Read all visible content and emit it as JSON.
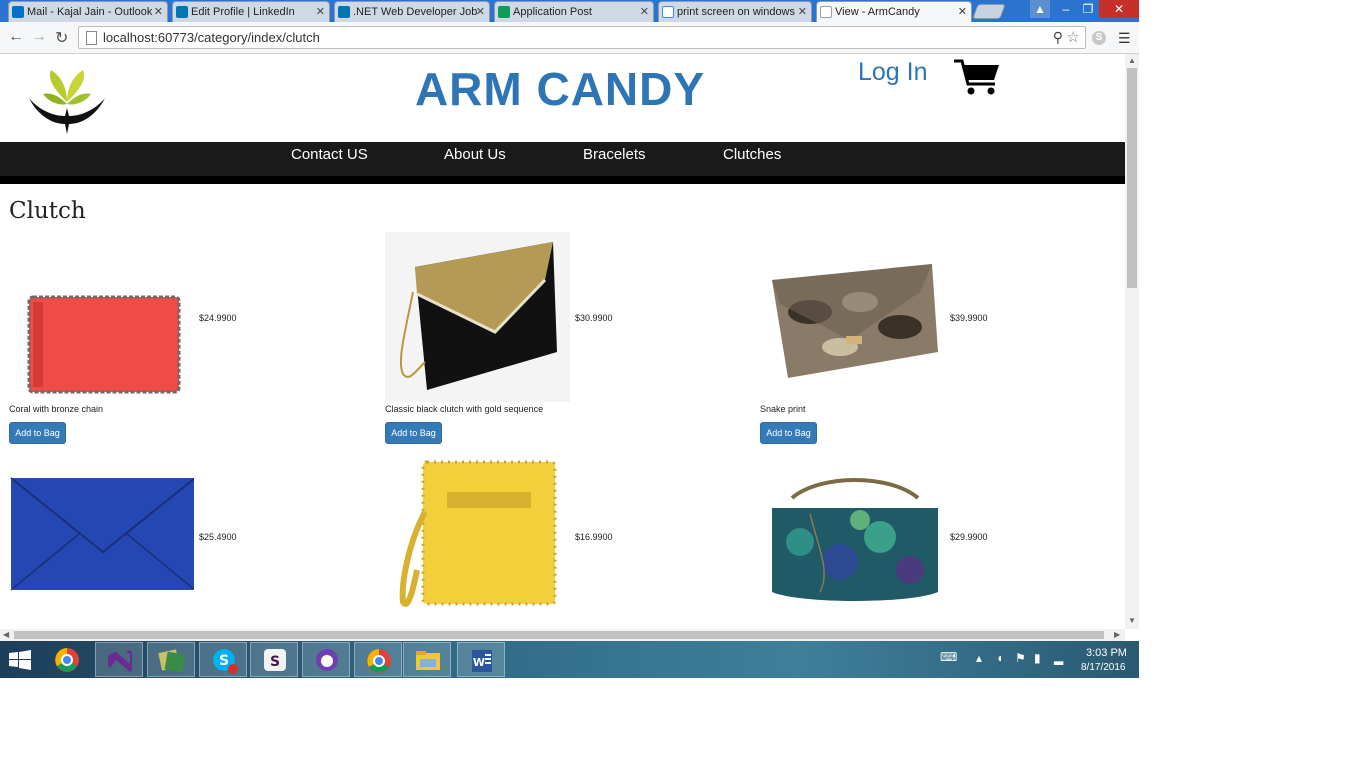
{
  "browser": {
    "tabs": [
      {
        "label": "Mail - Kajal Jain - Outlook",
        "icon": "mail-icon",
        "color": "#0072c6"
      },
      {
        "label": "Edit Profile | LinkedIn",
        "icon": "linkedin-icon",
        "color": "#0077b5"
      },
      {
        "label": ".NET Web Developer Job",
        "icon": "linkedin-icon",
        "color": "#0077b5"
      },
      {
        "label": "Application Post",
        "icon": "sheets-icon",
        "color": "#0f9d58"
      },
      {
        "label": "print screen on windows",
        "icon": "google-icon",
        "color": "#4285f4"
      },
      {
        "label": "View - ArmCandy",
        "icon": "page-icon",
        "color": "#9aa0a6"
      }
    ],
    "url": "localhost:60773/category/index/clutch"
  },
  "site": {
    "title": "ARM CANDY",
    "login": "Log In",
    "nav": [
      "Contact US",
      "About Us",
      "Bracelets",
      "Clutches"
    ]
  },
  "category": {
    "title": "Clutch",
    "add_label": "Add to Bag",
    "products": [
      {
        "price": "$24.9900",
        "desc": "Coral with bronze chain"
      },
      {
        "price": "$30.9900",
        "desc": "Classic black clutch with gold sequence"
      },
      {
        "price": "$39.9900",
        "desc": "Snake print"
      },
      {
        "price": "$25.4900",
        "desc": ""
      },
      {
        "price": "$16.9900",
        "desc": ""
      },
      {
        "price": "$29.9900",
        "desc": ""
      }
    ]
  },
  "taskbar": {
    "time": "3:03 PM",
    "date": "8/17/2016"
  },
  "colors": {
    "brand": "#2e75b6",
    "button": "#337ab7",
    "navbar": "#1a1a1a"
  }
}
